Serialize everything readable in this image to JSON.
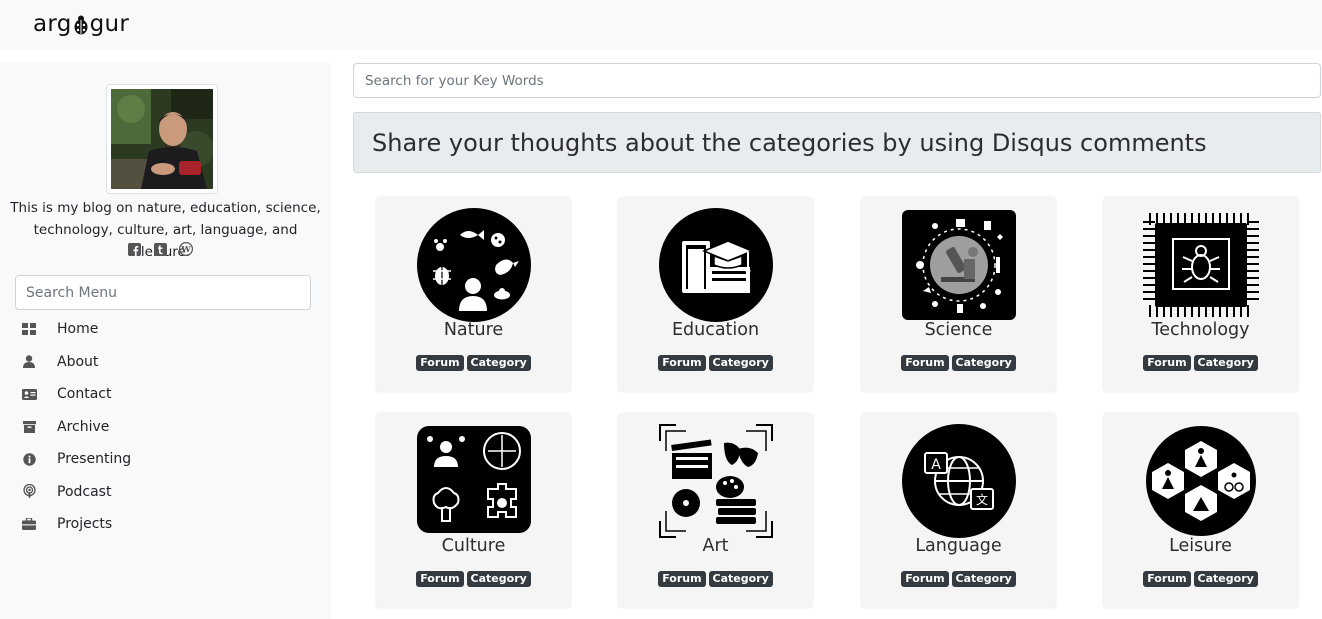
{
  "brand": {
    "part1": "arg",
    "part2": "gur"
  },
  "profile": {
    "bio": "This is my blog on nature, education, science, technology, culture, art, language, and leisure.",
    "socials": [
      "facebook-icon",
      "tumblr-icon",
      "wordpress-icon"
    ]
  },
  "menu_search": {
    "placeholder": "Search Menu"
  },
  "menu": [
    {
      "label": "Home",
      "icon": "grid-icon"
    },
    {
      "label": "About",
      "icon": "user-icon"
    },
    {
      "label": "Contact",
      "icon": "address-card-icon"
    },
    {
      "label": "Archive",
      "icon": "archive-box-icon"
    },
    {
      "label": "Presenting",
      "icon": "info-circle-icon"
    },
    {
      "label": "Podcast",
      "icon": "podcast-icon"
    },
    {
      "label": "Projects",
      "icon": "briefcase-icon"
    }
  ],
  "main_search": {
    "placeholder": "Search for your Key Words"
  },
  "heading": "Share your thoughts about the categories by using Disqus comments",
  "badges": {
    "forum": "Forum",
    "category": "Category"
  },
  "cards": [
    {
      "title": "Nature",
      "icon": "nature-icon"
    },
    {
      "title": "Education",
      "icon": "education-icon"
    },
    {
      "title": "Science",
      "icon": "science-icon"
    },
    {
      "title": "Technology",
      "icon": "technology-chip-icon"
    },
    {
      "title": "Culture",
      "icon": "culture-icon"
    },
    {
      "title": "Art",
      "icon": "art-icon"
    },
    {
      "title": "Language",
      "icon": "language-icon"
    },
    {
      "title": "Leisure",
      "icon": "leisure-icon"
    }
  ],
  "colors": {
    "badge": "#343a40",
    "card_bg": "#f5f5f5",
    "sidebar_bg": "#f8f9fa",
    "jumbotron_bg": "#e9ecef"
  }
}
